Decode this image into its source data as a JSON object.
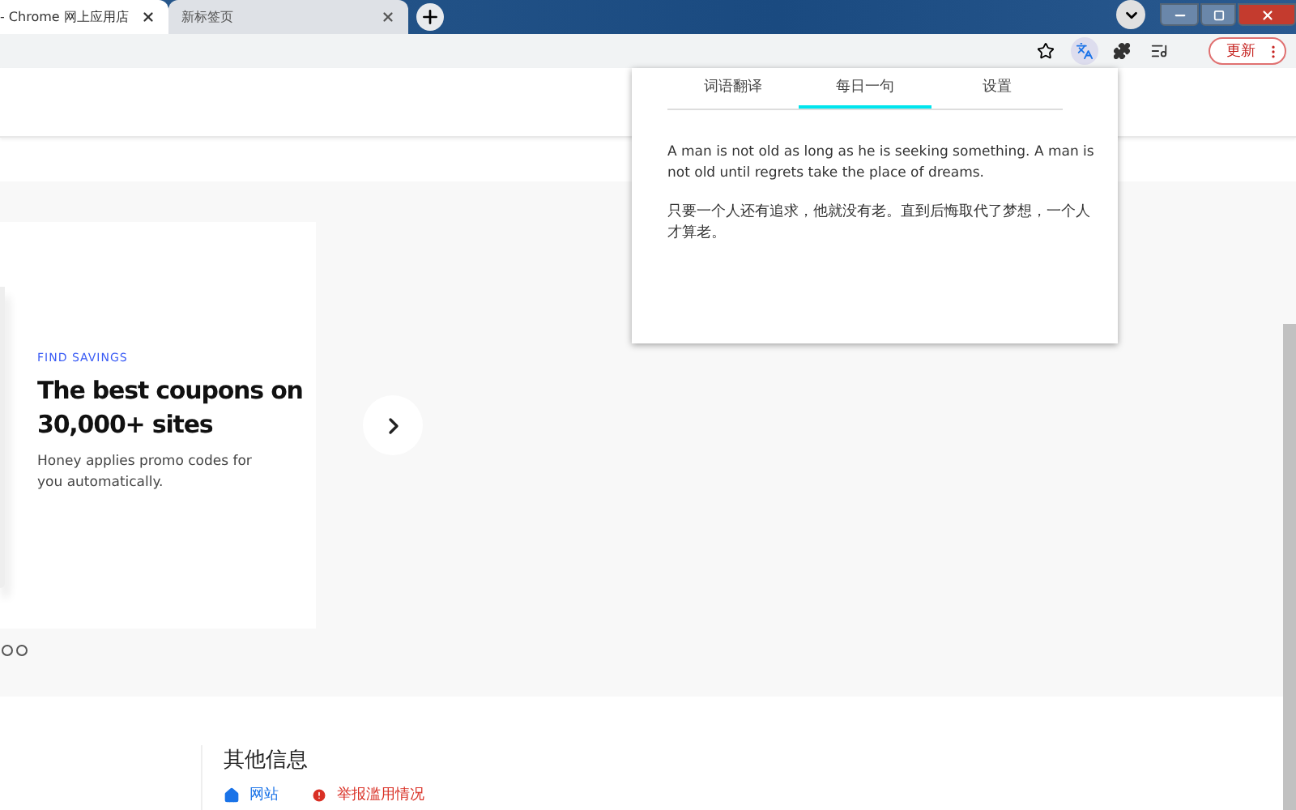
{
  "browser_tabs": [
    {
      "title": "- Chrome 网上应用店",
      "selected": true
    },
    {
      "title": "新标签页",
      "selected": false
    }
  ],
  "update_button": {
    "label": "更新"
  },
  "popup": {
    "tabs": [
      {
        "label": "词语翻译",
        "selected": false
      },
      {
        "label": "每日一句",
        "selected": true
      },
      {
        "label": "设置",
        "selected": false
      }
    ],
    "english": "A man is not old as long as he is seeking something. A man is not old until regrets take the place of dreams.",
    "chinese": "只要一个人还有追求，他就没有老。直到后悔取代了梦想，一个人才算老。"
  },
  "promo": {
    "eyebrow": "FIND SAVINGS",
    "headline": "The best coupons on 30,000+ sites",
    "body": "Honey applies promo codes for you automatically."
  },
  "carousel_dots": [
    {
      "selected": false
    },
    {
      "selected": false
    }
  ],
  "more_info": {
    "title": "其他信息",
    "links": [
      {
        "label": "网站",
        "kind": "site"
      },
      {
        "label": "举报滥用情况",
        "kind": "report"
      }
    ]
  }
}
